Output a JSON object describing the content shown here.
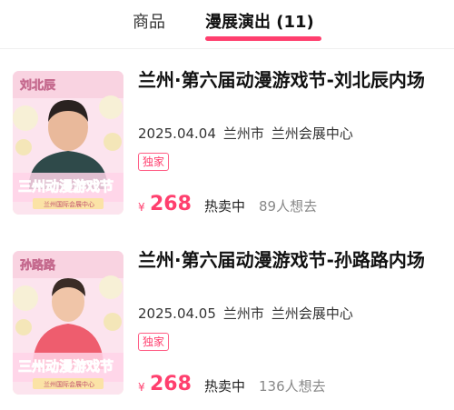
{
  "tabs": {
    "goods_label": "商品",
    "shows_label": "漫展演出 (11)",
    "active_color": "#ff3f6e"
  },
  "items": [
    {
      "title": "兰州·第六届动漫游戏节-刘北辰内场",
      "date": "2025.04.04",
      "city": "兰州市",
      "venue": "兰州会展中心",
      "badge": "独家",
      "currency": "¥",
      "price": "268",
      "status": "热卖中",
      "want": "89人想去",
      "poster": {
        "guest_name": "刘北辰",
        "shirt_color": "#2f4a4a",
        "headline": "三州动漫游戏节",
        "sub": "兰州国际会展中心"
      }
    },
    {
      "title": "兰州·第六届动漫游戏节-孙路路内场",
      "date": "2025.04.05",
      "city": "兰州市",
      "venue": "兰州会展中心",
      "badge": "独家",
      "currency": "¥",
      "price": "268",
      "status": "热卖中",
      "want": "136人想去",
      "poster": {
        "guest_name": "孙路路",
        "shirt_color": "#ee5d6e",
        "headline": "三州动漫游戏节",
        "sub": "兰州国际会展中心"
      }
    }
  ],
  "colors": {
    "price": "#ff3f6e",
    "muted": "#888888"
  }
}
